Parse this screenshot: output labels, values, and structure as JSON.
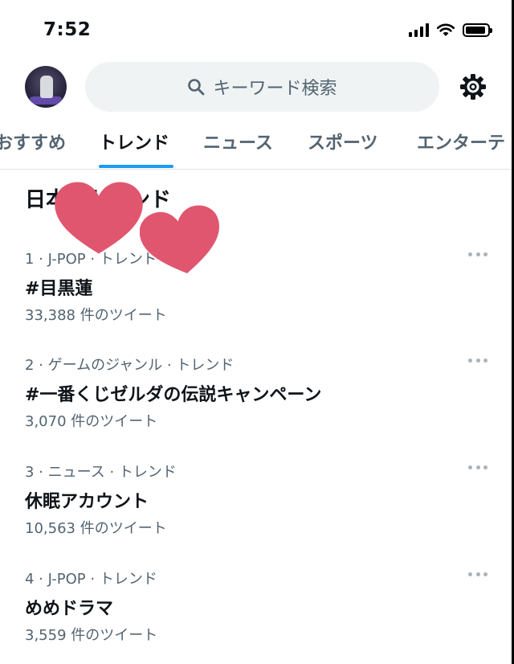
{
  "status_bar": {
    "time": "7:52"
  },
  "search": {
    "placeholder": "キーワード検索"
  },
  "tabs": [
    {
      "label": "おすすめ"
    },
    {
      "label": "トレンド"
    },
    {
      "label": "ニュース"
    },
    {
      "label": "スポーツ"
    },
    {
      "label": "エンターテ"
    }
  ],
  "section": {
    "title": "日本のトレンド"
  },
  "trends": [
    {
      "meta": "1 · J-POP · トレンド",
      "name": "#目黒蓮",
      "count": "33,388 件のツイート"
    },
    {
      "meta": "2 · ゲームのジャンル · トレンド",
      "name": "#一番くじゼルダの伝説キャンペーン",
      "count": "3,070 件のツイート"
    },
    {
      "meta": "3 · ニュース · トレンド",
      "name": "休眠アカウント",
      "count": "10,563 件のツイート"
    },
    {
      "meta": "4 · J-POP · トレンド",
      "name": "めめドラマ",
      "count": "3,559 件のツイート"
    }
  ],
  "colors": {
    "accent": "#1d9bf0",
    "heart": "#e0566e",
    "muted": "#536471",
    "search_bg": "#eff3f4"
  },
  "icons": [
    "search-icon",
    "gear-icon",
    "more-icon",
    "heart-sticker-icon",
    "signal-icon",
    "wifi-icon",
    "battery-icon"
  ]
}
